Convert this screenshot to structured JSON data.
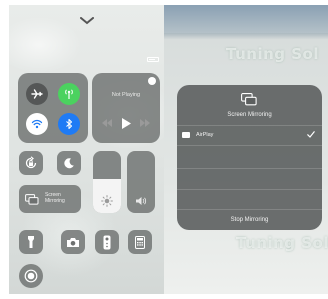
{
  "control_center": {
    "status_bar": {
      "carrier": "",
      "battery": ""
    },
    "now_playing": {
      "label": "Not Playing"
    },
    "screen_mirroring_tile": {
      "label": "Screen Mirroring"
    },
    "cellular_color": "#4bd25f",
    "bluetooth_color": "#1f7bf5",
    "brightness_level": 0.55,
    "volume_level": 0.0
  },
  "mirroring_panel": {
    "title": "Screen Mirroring",
    "devices": [
      {
        "name": "AirPlay",
        "icon": "appletv-icon",
        "selected": true
      }
    ],
    "stop_label": "Stop Mirroring"
  },
  "watermark": {
    "top": "Tuning Sol",
    "bottom": "Tuning Sol"
  }
}
